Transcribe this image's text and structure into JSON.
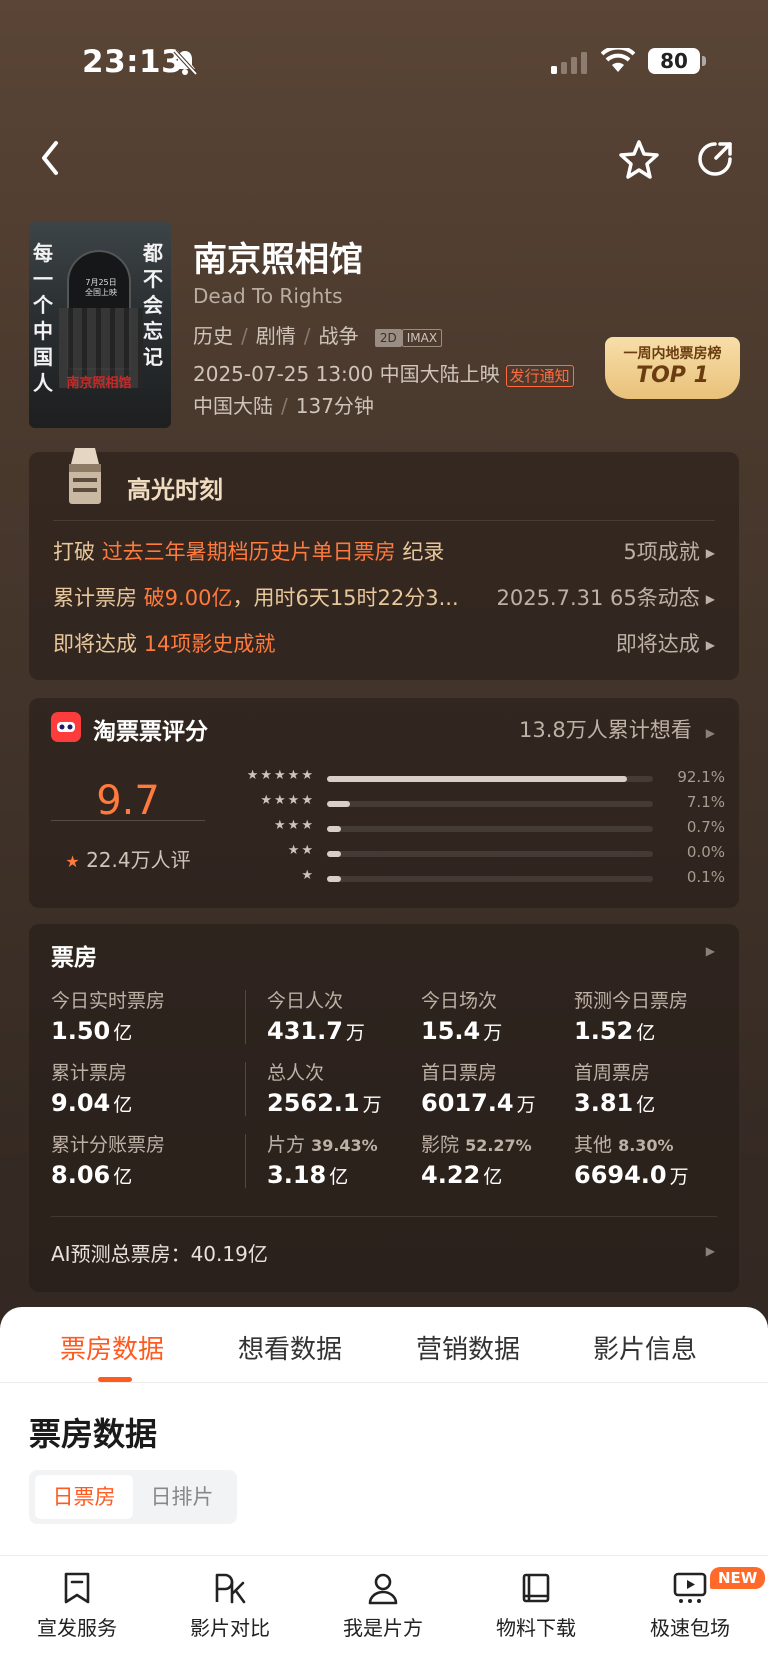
{
  "status": {
    "time": "23:13",
    "battery": "80"
  },
  "movie": {
    "title": "南京照相馆",
    "en_title": "Dead To Rights",
    "genres": [
      "历史",
      "剧情",
      "战争"
    ],
    "formats": [
      "2D",
      "IMAX"
    ],
    "release": "2025-07-25 13:00 中国大陆上映",
    "release_notice": "发行通知",
    "region": "中国大陆",
    "duration": "137分钟",
    "poster": {
      "left_text": "每一个中国人",
      "right_text": "都不会忘记",
      "date": "7月25日 全国上映",
      "logo": "南京照相馆"
    }
  },
  "badge": {
    "line1": "一周内地票房榜",
    "line2": "TOP 1"
  },
  "highlights": {
    "title": "高光时刻",
    "rows": [
      {
        "prefix": "打破 ",
        "highlight": "过去三年暑期档历史片单日票房",
        "suffix": " 纪录",
        "right": "5项成就"
      },
      {
        "prefix": "累计票房 ",
        "highlight": "破9.00亿",
        "suffix": "，用时6天15时22分3...",
        "right": "2025.7.31  65条动态"
      },
      {
        "prefix": "即将达成 ",
        "highlight": "14项影史成就",
        "suffix": "",
        "right": "即将达成"
      }
    ]
  },
  "rating": {
    "title": "淘票票评分",
    "want": "13.8万人累计想看",
    "score": "9.7",
    "count": "22.4万人评",
    "bars": [
      {
        "stars": "★★★★★",
        "pct": "92.1%",
        "value": 0.921
      },
      {
        "stars": "★★★★",
        "pct": "7.1%",
        "value": 0.071
      },
      {
        "stars": "★★★",
        "pct": "0.7%",
        "value": 0.007
      },
      {
        "stars": "★★",
        "pct": "0.0%",
        "value": 0.0
      },
      {
        "stars": "★",
        "pct": "0.1%",
        "value": 0.001
      }
    ]
  },
  "boxoffice": {
    "title": "票房",
    "cells": [
      [
        {
          "label": "今日实时票房",
          "label_sub": "",
          "value": "1.50",
          "unit": "亿"
        },
        {
          "label": "今日人次",
          "label_sub": "",
          "value": "431.7",
          "unit": "万"
        },
        {
          "label": "今日场次",
          "label_sub": "",
          "value": "15.4",
          "unit": "万"
        },
        {
          "label": "预测今日票房",
          "label_sub": "",
          "value": "1.52",
          "unit": "亿"
        }
      ],
      [
        {
          "label": "累计票房",
          "label_sub": "",
          "value": "9.04",
          "unit": "亿"
        },
        {
          "label": "总人次",
          "label_sub": "",
          "value": "2562.1",
          "unit": "万"
        },
        {
          "label": "首日票房",
          "label_sub": "",
          "value": "6017.4",
          "unit": "万"
        },
        {
          "label": "首周票房",
          "label_sub": "",
          "value": "3.81",
          "unit": "亿"
        }
      ],
      [
        {
          "label": "累计分账票房",
          "label_sub": "",
          "value": "8.06",
          "unit": "亿"
        },
        {
          "label": "片方",
          "label_sub": "39.43%",
          "value": "3.18",
          "unit": "亿"
        },
        {
          "label": "影院",
          "label_sub": "52.27%",
          "value": "4.22",
          "unit": "亿"
        },
        {
          "label": "其他",
          "label_sub": "8.30%",
          "value": "6694.0",
          "unit": "万"
        }
      ]
    ],
    "ai_prediction": "AI预测总票房：40.19亿"
  },
  "tabs": [
    "票房数据",
    "想看数据",
    "营销数据",
    "影片信息"
  ],
  "section": {
    "title": "票房数据",
    "segments": [
      "日票房",
      "日排片"
    ]
  },
  "nav": [
    "宣发服务",
    "影片对比",
    "我是片方",
    "物料下载",
    "极速包场"
  ],
  "new_badge": "NEW",
  "colors": {
    "accent": "#ff5a1f",
    "highlight": "#ff7a3d",
    "gold": "#e8c79a"
  }
}
